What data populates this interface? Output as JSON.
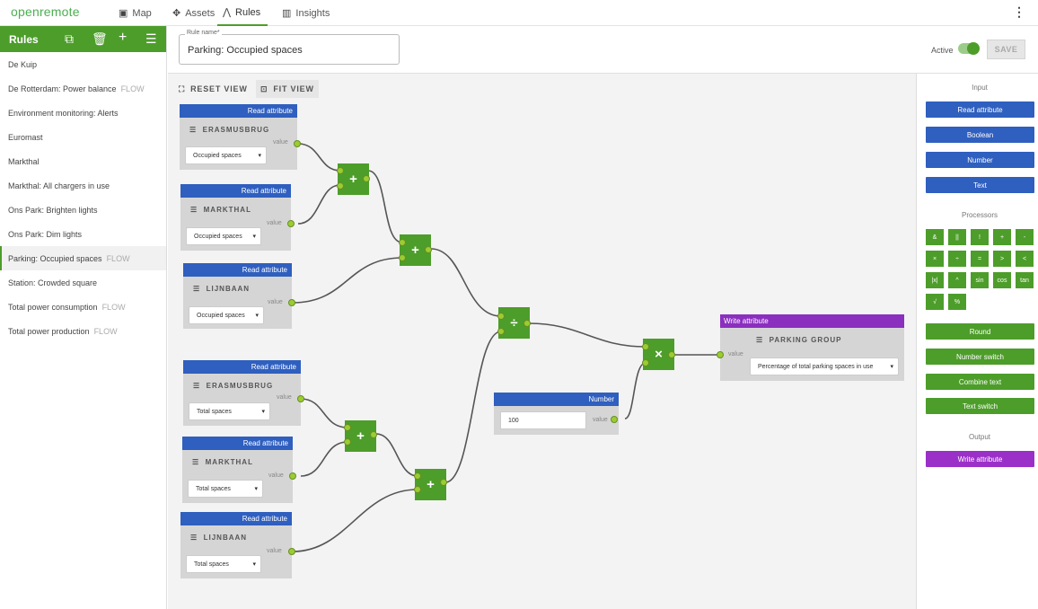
{
  "app": {
    "logo": "openremote",
    "nav": [
      {
        "label": "Map",
        "icon": "map-icon"
      },
      {
        "label": "Assets",
        "icon": "assets-icon"
      },
      {
        "label": "Rules",
        "icon": "rules-icon"
      },
      {
        "label": "Insights",
        "icon": "insights-icon"
      }
    ]
  },
  "sidebar": {
    "title": "Rules",
    "rules": [
      {
        "name": "De Kuip",
        "tag": ""
      },
      {
        "name": "De Rotterdam: Power balance",
        "tag": "FLOW"
      },
      {
        "name": "Environment monitoring: Alerts",
        "tag": ""
      },
      {
        "name": "Euromast",
        "tag": ""
      },
      {
        "name": "Markthal",
        "tag": ""
      },
      {
        "name": "Markthal: All chargers in use",
        "tag": ""
      },
      {
        "name": "Ons Park: Brighten lights",
        "tag": ""
      },
      {
        "name": "Ons Park: Dim lights",
        "tag": ""
      },
      {
        "name": "Parking: Occupied spaces",
        "tag": "FLOW"
      },
      {
        "name": "Station: Crowded square",
        "tag": ""
      },
      {
        "name": "Total power consumption",
        "tag": "FLOW"
      },
      {
        "name": "Total power production",
        "tag": "FLOW"
      }
    ]
  },
  "header": {
    "rule_name_label": "Rule name*",
    "rule_name_value": "Parking: Occupied spaces",
    "active_label": "Active",
    "save_label": "SAVE"
  },
  "canvas": {
    "reset_view": "RESET VIEW",
    "fit_view": "FIT VIEW",
    "read_title": "Read attribute",
    "write_title": "Write attribute",
    "number_title": "Number",
    "value_label": "value",
    "read_nodes": [
      {
        "asset": "ERASMUSBRUG",
        "attribute": "Occupied spaces"
      },
      {
        "asset": "MARKTHAL",
        "attribute": "Occupied spaces"
      },
      {
        "asset": "LIJNBAAN",
        "attribute": "Occupied spaces"
      },
      {
        "asset": "ERASMUSBRUG",
        "attribute": "Total spaces"
      },
      {
        "asset": "MARKTHAL",
        "attribute": "Total spaces"
      },
      {
        "asset": "LIJNBAAN",
        "attribute": "Total spaces"
      }
    ],
    "operators": [
      "+",
      "+",
      "÷",
      "×",
      "+",
      "+"
    ],
    "number_value": "100",
    "write_node": {
      "asset": "PARKING GROUP",
      "attribute": "Percentage of total parking spaces in use"
    }
  },
  "palette": {
    "input_heading": "Input",
    "inputs": [
      "Read attribute",
      "Boolean",
      "Number",
      "Text"
    ],
    "processors_heading": "Processors",
    "operators": [
      "&",
      "||",
      "!",
      "+",
      "-",
      "×",
      "÷",
      "=",
      ">",
      "<",
      "|x|",
      "^",
      "sin",
      "cos",
      "tan",
      "√",
      "%"
    ],
    "processors": [
      "Round",
      "Number switch",
      "Combine text",
      "Text switch"
    ],
    "output_heading": "Output",
    "outputs": [
      "Write attribute"
    ]
  },
  "colors": {
    "brand_green": "#4d9d2a",
    "read_blue": "#2f5fbf",
    "write_purple": "#8b2fbf"
  }
}
